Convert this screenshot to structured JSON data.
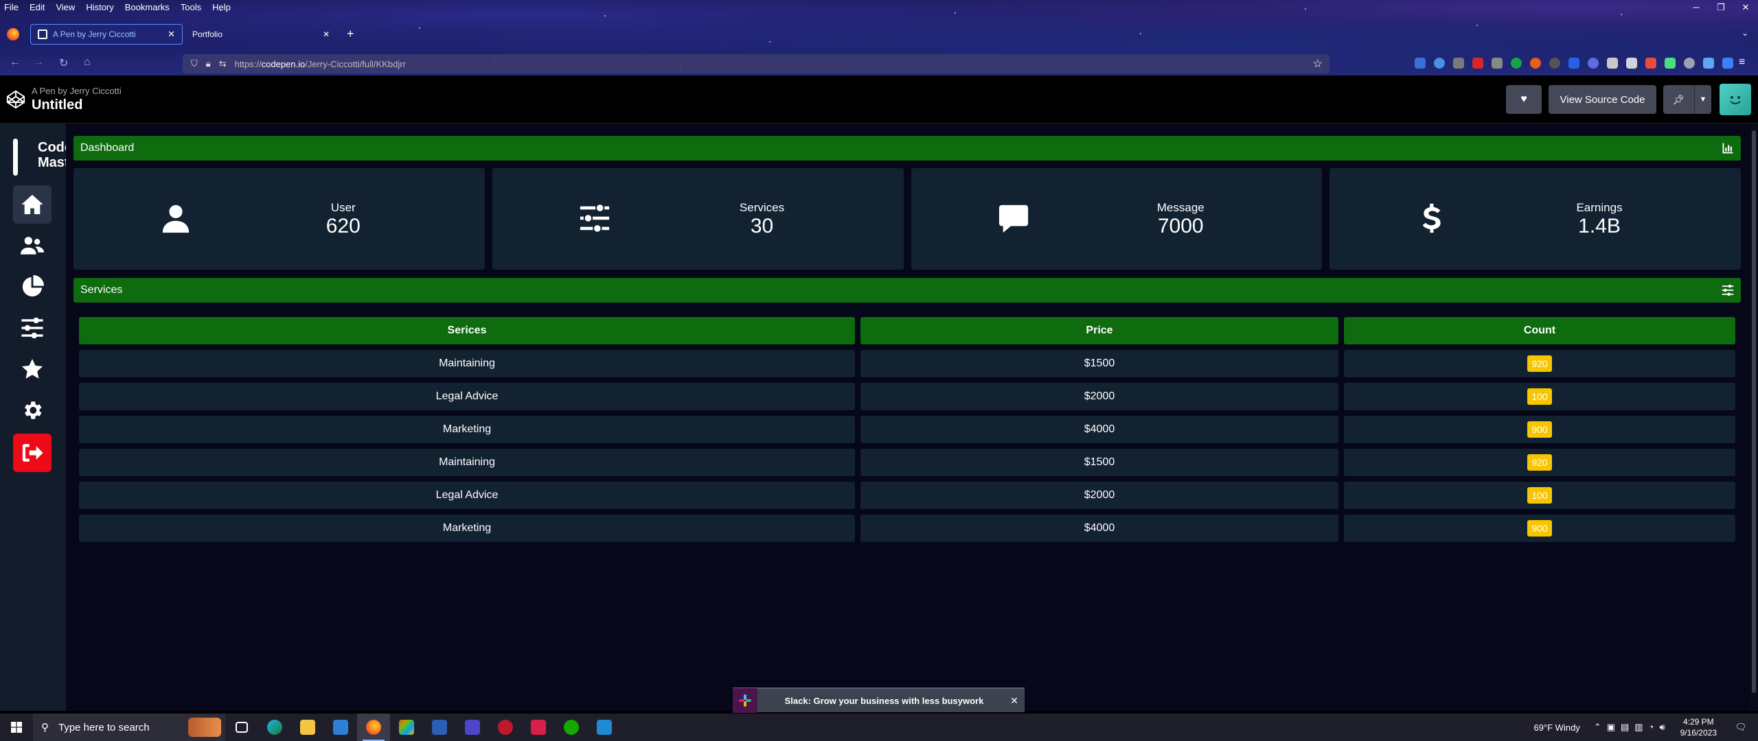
{
  "browser": {
    "menu": [
      "File",
      "Edit",
      "View",
      "History",
      "Bookmarks",
      "Tools",
      "Help"
    ],
    "tabs": [
      {
        "title": "A Pen by Jerry Ciccotti",
        "active": true
      },
      {
        "title": "Portfolio",
        "active": false
      }
    ],
    "url_prefix": "https://",
    "url_host": "codepen.io",
    "url_path": "/Jerry-Ciccotti/full/KKbdjrr"
  },
  "codepen": {
    "byline": "A Pen by Jerry Ciccotti",
    "title": "Untitled",
    "view_source": "View Source Code"
  },
  "sidebar": {
    "brand": "Code\nMast",
    "items": [
      {
        "icon": "home-icon",
        "active": true
      },
      {
        "icon": "users-icon",
        "active": false
      },
      {
        "icon": "pie-chart-icon",
        "active": false
      },
      {
        "icon": "sliders-icon",
        "active": false
      },
      {
        "icon": "star-icon",
        "active": false
      },
      {
        "icon": "gear-icon",
        "active": false
      },
      {
        "icon": "logout-icon",
        "active": false
      }
    ]
  },
  "dashboard": {
    "title": "Dashboard",
    "cards": [
      {
        "label": "User",
        "value": "620",
        "icon": "user-icon"
      },
      {
        "label": "Services",
        "value": "30",
        "icon": "sliders-icon"
      },
      {
        "label": "Message",
        "value": "7000",
        "icon": "message-icon"
      },
      {
        "label": "Earnings",
        "value": "1.4B",
        "icon": "dollar-icon"
      }
    ]
  },
  "services": {
    "title": "Services",
    "headers": [
      "Serices",
      "Price",
      "Count"
    ],
    "rows": [
      {
        "service": "Maintaining",
        "price": "$1500",
        "count": "920"
      },
      {
        "service": "Legal Advice",
        "price": "$2000",
        "count": "100"
      },
      {
        "service": "Marketing",
        "price": "$4000",
        "count": "900"
      },
      {
        "service": "Maintaining",
        "price": "$1500",
        "count": "920"
      },
      {
        "service": "Legal Advice",
        "price": "$2000",
        "count": "100"
      },
      {
        "service": "Marketing",
        "price": "$4000",
        "count": "900"
      }
    ]
  },
  "toast": {
    "text": "Slack: Grow your business with less busywork"
  },
  "taskbar": {
    "search_placeholder": "Type here to search",
    "weather": "69°F  Windy",
    "time": "4:29 PM",
    "date": "9/16/2023"
  },
  "colors": {
    "accent_green": "#0e6b0e",
    "card_bg": "#122231",
    "badge": "#f7c600",
    "logout_red": "#ee0a16"
  }
}
